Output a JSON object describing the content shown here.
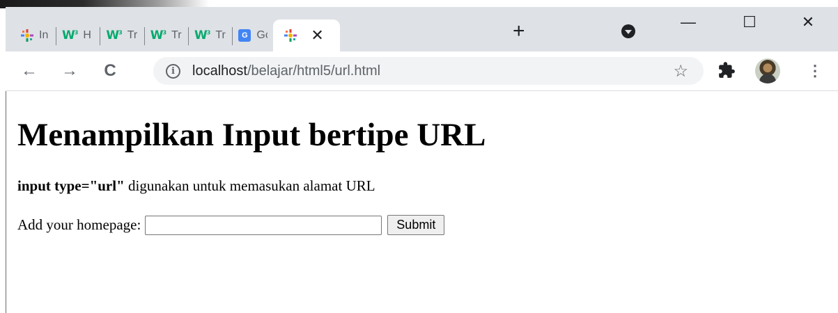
{
  "browser": {
    "tabs": [
      {
        "label": "In",
        "icon": "puzzle-star-icon"
      },
      {
        "label": "H",
        "icon": "w3schools-icon"
      },
      {
        "label": "Tr",
        "icon": "w3schools-icon"
      },
      {
        "label": "Tr",
        "icon": "w3schools-icon"
      },
      {
        "label": "Tr",
        "icon": "w3schools-icon"
      },
      {
        "label": "Gc",
        "icon": "google-translate-icon"
      }
    ],
    "active_tab": {
      "label": "",
      "icon": "puzzle-star-icon",
      "close": "✕"
    },
    "new_tab": "+",
    "window_controls": {
      "minimize": "—",
      "maximize": "☐",
      "close": "✕"
    },
    "nav": {
      "back": "←",
      "forward": "→",
      "reload": "C"
    },
    "address": {
      "host": "localhost",
      "path": "/belajar/html5/url.html",
      "info": "i"
    },
    "bookmark_star": "☆",
    "menu": "⋮"
  },
  "page": {
    "title": "Menampilkan Input bertipe URL",
    "desc_bold": "input type=\"url\"",
    "desc_rest": " digunakan untuk memasukan alamat URL",
    "form_label": "Add your homepage:",
    "input_value": "",
    "submit_label": "Submit"
  },
  "colors": {
    "tabstrip_bg": "#dee1e6",
    "omnibox_bg": "#f1f3f4",
    "w3_green": "#04aa6d"
  }
}
